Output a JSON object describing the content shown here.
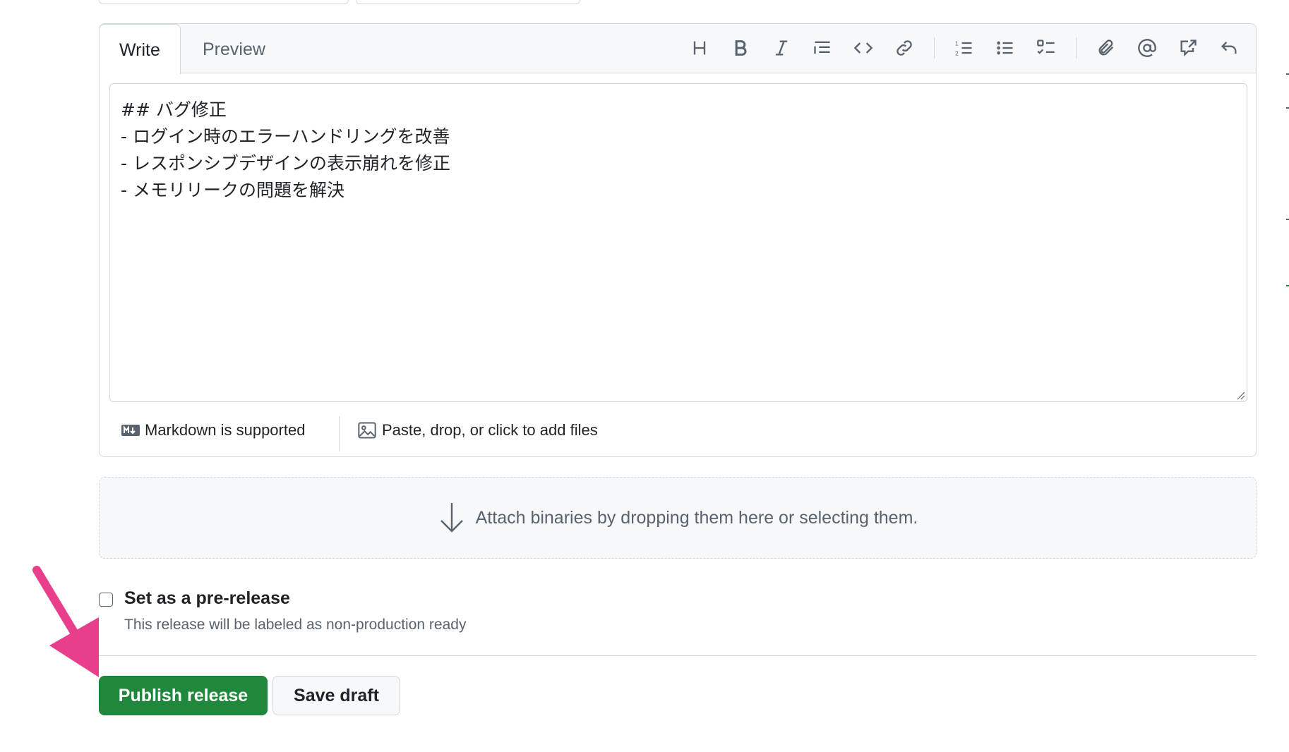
{
  "editor": {
    "tabs": [
      {
        "label": "Write",
        "active": true
      },
      {
        "label": "Preview",
        "active": false
      }
    ],
    "toolbar": [
      {
        "icon": "heading-icon"
      },
      {
        "icon": "bold-icon"
      },
      {
        "icon": "italic-icon"
      },
      {
        "icon": "quote-icon"
      },
      {
        "icon": "code-icon"
      },
      {
        "icon": "link-icon"
      },
      {
        "icon": "numbered-list-icon"
      },
      {
        "icon": "unordered-list-icon"
      },
      {
        "icon": "task-list-icon"
      },
      {
        "icon": "attach-icon"
      },
      {
        "icon": "mention-icon"
      },
      {
        "icon": "cross-reference-icon"
      },
      {
        "icon": "undo-icon"
      }
    ],
    "text_lines": [
      "## バグ修正",
      "- ログイン時のエラーハンドリングを改善",
      "- レスポンシブデザインの表示崩れを修正",
      "- メモリリークの問題を解決"
    ],
    "footer": {
      "markdown_label": "Markdown is supported",
      "files_label": "Paste, drop, or click to add files"
    }
  },
  "attach": {
    "label": "Attach binaries by dropping them here or selecting them."
  },
  "prerelease": {
    "checked": false,
    "title": "Set as a pre-release",
    "description": "This release will be labeled as non-production ready"
  },
  "actions": {
    "publish_label": "Publish release",
    "draft_label": "Save draft"
  },
  "colors": {
    "primary": "#1f883d",
    "annotation_arrow": "#e83e8c",
    "border": "#d0d7de",
    "muted": "#59636e"
  }
}
